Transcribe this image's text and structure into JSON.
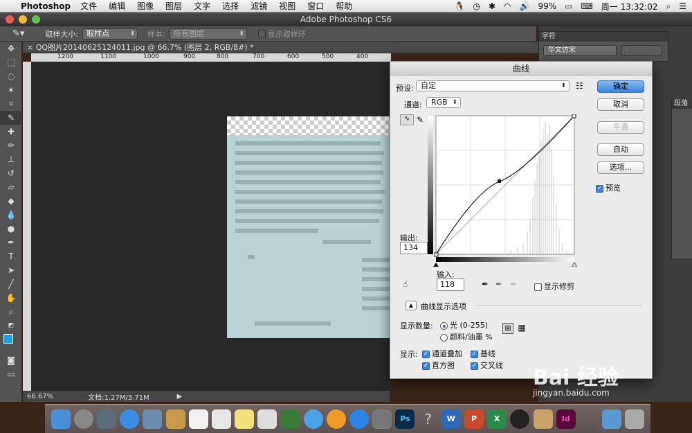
{
  "menubar": {
    "app_name": "Photoshop",
    "items": [
      "文件",
      "编辑",
      "图像",
      "图层",
      "文字",
      "选择",
      "滤镜",
      "视图",
      "窗口",
      "帮助"
    ],
    "battery": "99%",
    "clock": "周一 13:32:02"
  },
  "window_title": "Adobe Photoshop CS6",
  "options_bar": {
    "sample_size_label": "取样大小:",
    "sample_size_value": "取样点",
    "sample_label": "样本:",
    "sample_value": "所有图层",
    "show_ring_label": "显示取样环"
  },
  "document_tab": "QQ图片20140625124011.jpg @ 66.7% (图层 2, RGB/8#) *",
  "ruler_ticks": [
    "1200",
    "1100",
    "1000",
    "900",
    "800",
    "700",
    "600",
    "500",
    "400",
    "300",
    "200"
  ],
  "status_bar": {
    "zoom": "66.67%",
    "doc_size": "文档:1.27M/3.71M"
  },
  "char_panel": {
    "title": "字符",
    "font": "华文仿宋",
    "style": "-"
  },
  "para_panel": {
    "title": "段落"
  },
  "curves_dialog": {
    "title": "曲线",
    "preset_label": "预设:",
    "preset_value": "自定",
    "channel_label": "通道:",
    "channel_value": "RGB",
    "output_label": "输出:",
    "output_value": "134",
    "input_label": "输入:",
    "input_value": "118",
    "show_clipping": "显示修剪",
    "curve_options": "曲线显示选项",
    "show_amount_label": "显示数量:",
    "light_option": "光 (0-255)",
    "pigment_option": "颜料/油墨 %",
    "show_label": "显示:",
    "channel_overlay": "通道叠加",
    "baseline": "基线",
    "histogram": "直方图",
    "intersection": "交叉线",
    "buttons": {
      "ok": "确定",
      "cancel": "取消",
      "smooth": "平滑",
      "auto": "自动",
      "options": "选项..."
    },
    "preview_label": "预览"
  },
  "watermark": {
    "brand": "Bai 经验",
    "url": "jingyan.baidu.com"
  }
}
